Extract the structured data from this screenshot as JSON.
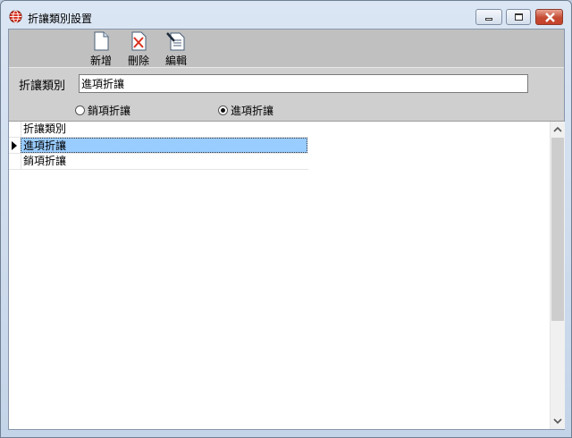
{
  "window": {
    "title": "折讓類別設置"
  },
  "toolbar": {
    "new_label": "新增",
    "delete_label": "刪除",
    "edit_label": "編輯"
  },
  "form": {
    "category_label": "折讓類別",
    "category_value": "進項折讓",
    "radio_sales_label": "銷項折讓",
    "radio_purchase_label": "進項折讓",
    "selected_radio": "進項折讓"
  },
  "grid": {
    "rows": [
      "折讓類別",
      "進項折讓",
      "銷項折讓"
    ],
    "selected_row": 1
  }
}
